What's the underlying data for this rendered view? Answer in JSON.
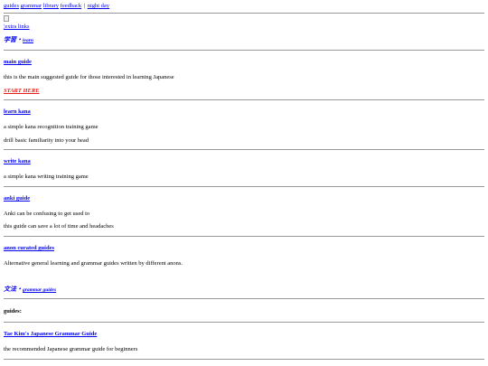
{
  "nav": {
    "links": [
      "guides",
      "grammar",
      "library",
      "feedback",
      "night day"
    ],
    "separator": "|"
  },
  "extra_links": "extra links",
  "sections": [
    {
      "kanji": "学習",
      "dot": "・",
      "label": "learn"
    }
  ],
  "main_guide": {
    "title": "main guide",
    "desc": "this is the main suggested guide for those interested in learning Japanese",
    "cta": "START HERE"
  },
  "learn_kana": {
    "title": "learn kana",
    "line1": "a simple kana recognition training game",
    "line2": "drill basic familiarity into your head"
  },
  "write_kana": {
    "title": "write kana",
    "line1": "a simple kana writing training game"
  },
  "anki_guide": {
    "title": "anki guide",
    "line1": "Anki can be confusing to get used to",
    "line2": "this guide can save a lot of time and headaches"
  },
  "anon_guides": {
    "title": "anon curated guides",
    "line1": "Alternative general learning and grammar guides written by different anons."
  },
  "grammar_section": {
    "kanji": "文法",
    "dot": "・",
    "label": "grammar guides"
  },
  "guides_label": "guides:",
  "tae_kim": {
    "title": "Tae Kim's Japanese Grammar Guide",
    "line1": "the recommended Japanese grammar guide for beginners"
  },
  "colors": {
    "link": "#0000ee",
    "start_here": "#e0201a",
    "divider": "#999999"
  }
}
